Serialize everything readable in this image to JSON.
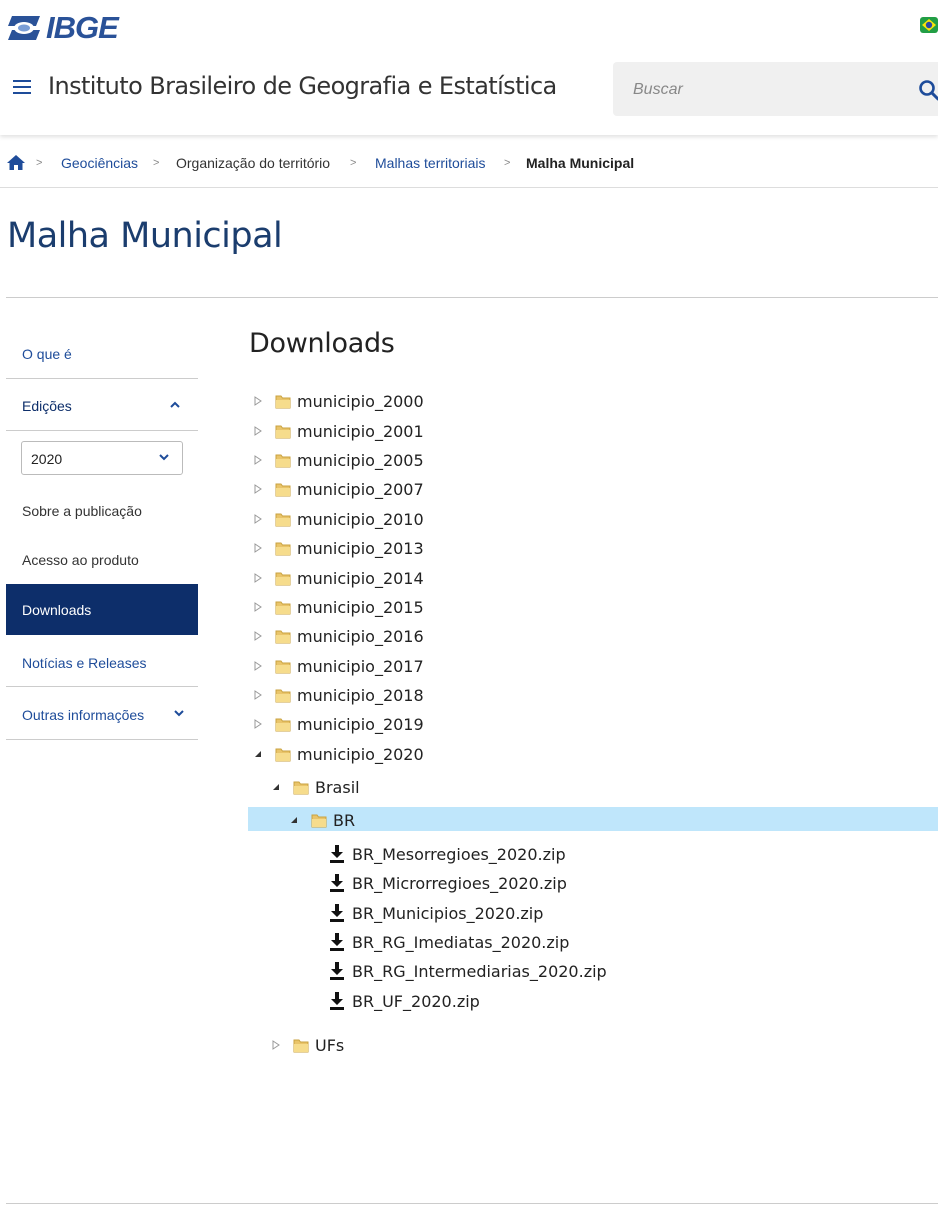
{
  "header": {
    "logo_text": "IBGE",
    "site_title": "Instituto Brasileiro de Geografia e Estatística",
    "search_placeholder": "Buscar"
  },
  "breadcrumb": {
    "items": [
      "Geociências",
      "Organização do território",
      "Malhas territoriais",
      "Malha Municipal"
    ],
    "separator": ">"
  },
  "page": {
    "title": "Malha Municipal"
  },
  "sidebar": {
    "o_que_e": "O que é",
    "edicoes": "Edições",
    "year_selected": "2020",
    "sobre": "Sobre a publicação",
    "acesso": "Acesso ao produto",
    "downloads": "Downloads",
    "noticias": "Notícias e Releases",
    "outras": "Outras informações"
  },
  "content": {
    "title": "Downloads",
    "folders": [
      "municipio_2000",
      "municipio_2001",
      "municipio_2005",
      "municipio_2007",
      "municipio_2010",
      "municipio_2013",
      "municipio_2014",
      "municipio_2015",
      "municipio_2016",
      "municipio_2017",
      "municipio_2018",
      "municipio_2019",
      "municipio_2020"
    ],
    "sub_brasil": "Brasil",
    "sub_br": "BR",
    "files": [
      "BR_Mesorregioes_2020.zip",
      "BR_Microrregioes_2020.zip",
      "BR_Municipios_2020.zip",
      "BR_RG_Imediatas_2020.zip",
      "BR_RG_Intermediarias_2020.zip",
      "BR_UF_2020.zip"
    ],
    "sub_ufs": "UFs"
  },
  "colors": {
    "brand_blue": "#1e4c9a",
    "title_blue": "#1b3d6e",
    "active_bg": "#0d2e6a",
    "selected_row": "#bfe6fb"
  }
}
